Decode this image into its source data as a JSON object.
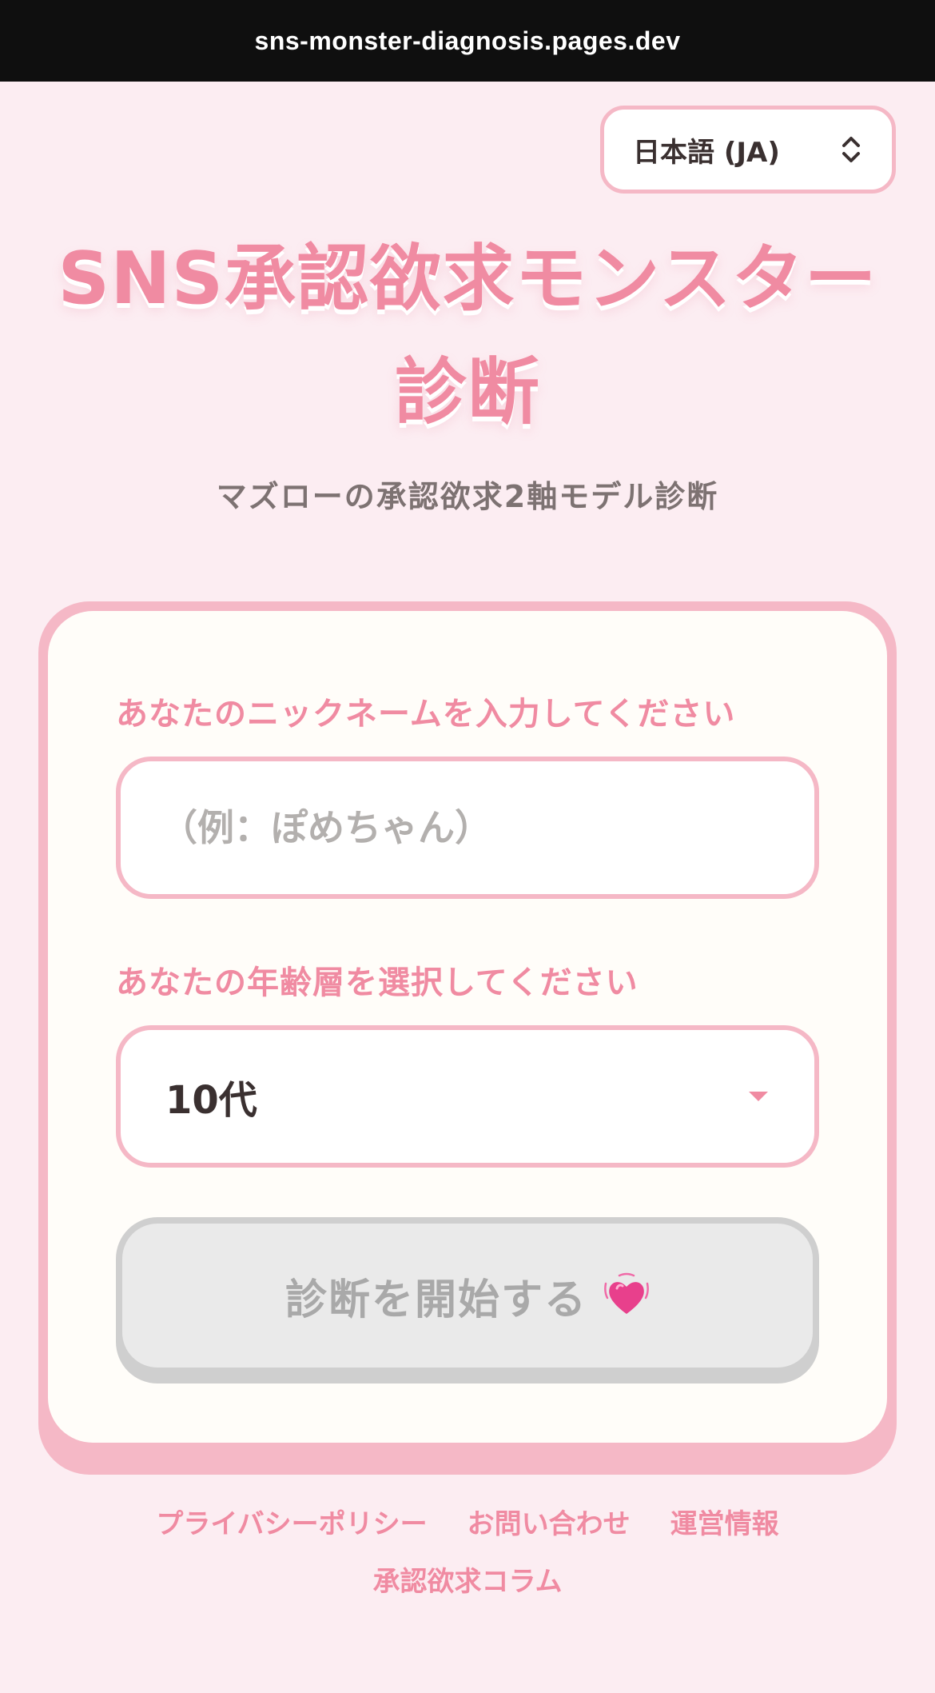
{
  "browser": {
    "url": "sns-monster-diagnosis.pages.dev"
  },
  "language_selector": {
    "selected": "日本語 (JA)"
  },
  "header": {
    "title_line1": "SNS承認欲求モンスター",
    "title_line2": "診断",
    "subtitle": "マズローの承認欲求2軸モデル診断"
  },
  "form": {
    "nickname_label": "あなたのニックネームを入力してください",
    "nickname_placeholder": "（例：ぽめちゃん）",
    "nickname_value": "",
    "age_label": "あなたの年齢層を選択してください",
    "age_selected": "10代",
    "start_button_label": "診断を開始する",
    "start_button_enabled": false
  },
  "footer": {
    "links": [
      "プライバシーポリシー",
      "お問い合わせ",
      "運営情報"
    ],
    "links_row2": [
      "承認欲求コラム"
    ]
  },
  "colors": {
    "background": "#fcedf2",
    "accent_pink": "#f08ba2",
    "border_pink": "#f5b8c6",
    "card": "#fffdf9",
    "disabled_button": "#eaeaea"
  },
  "icons": {
    "language_selector": "updown-chevron-icon",
    "age_selector": "caret-down-icon",
    "start_button": "growing-heart-icon"
  }
}
